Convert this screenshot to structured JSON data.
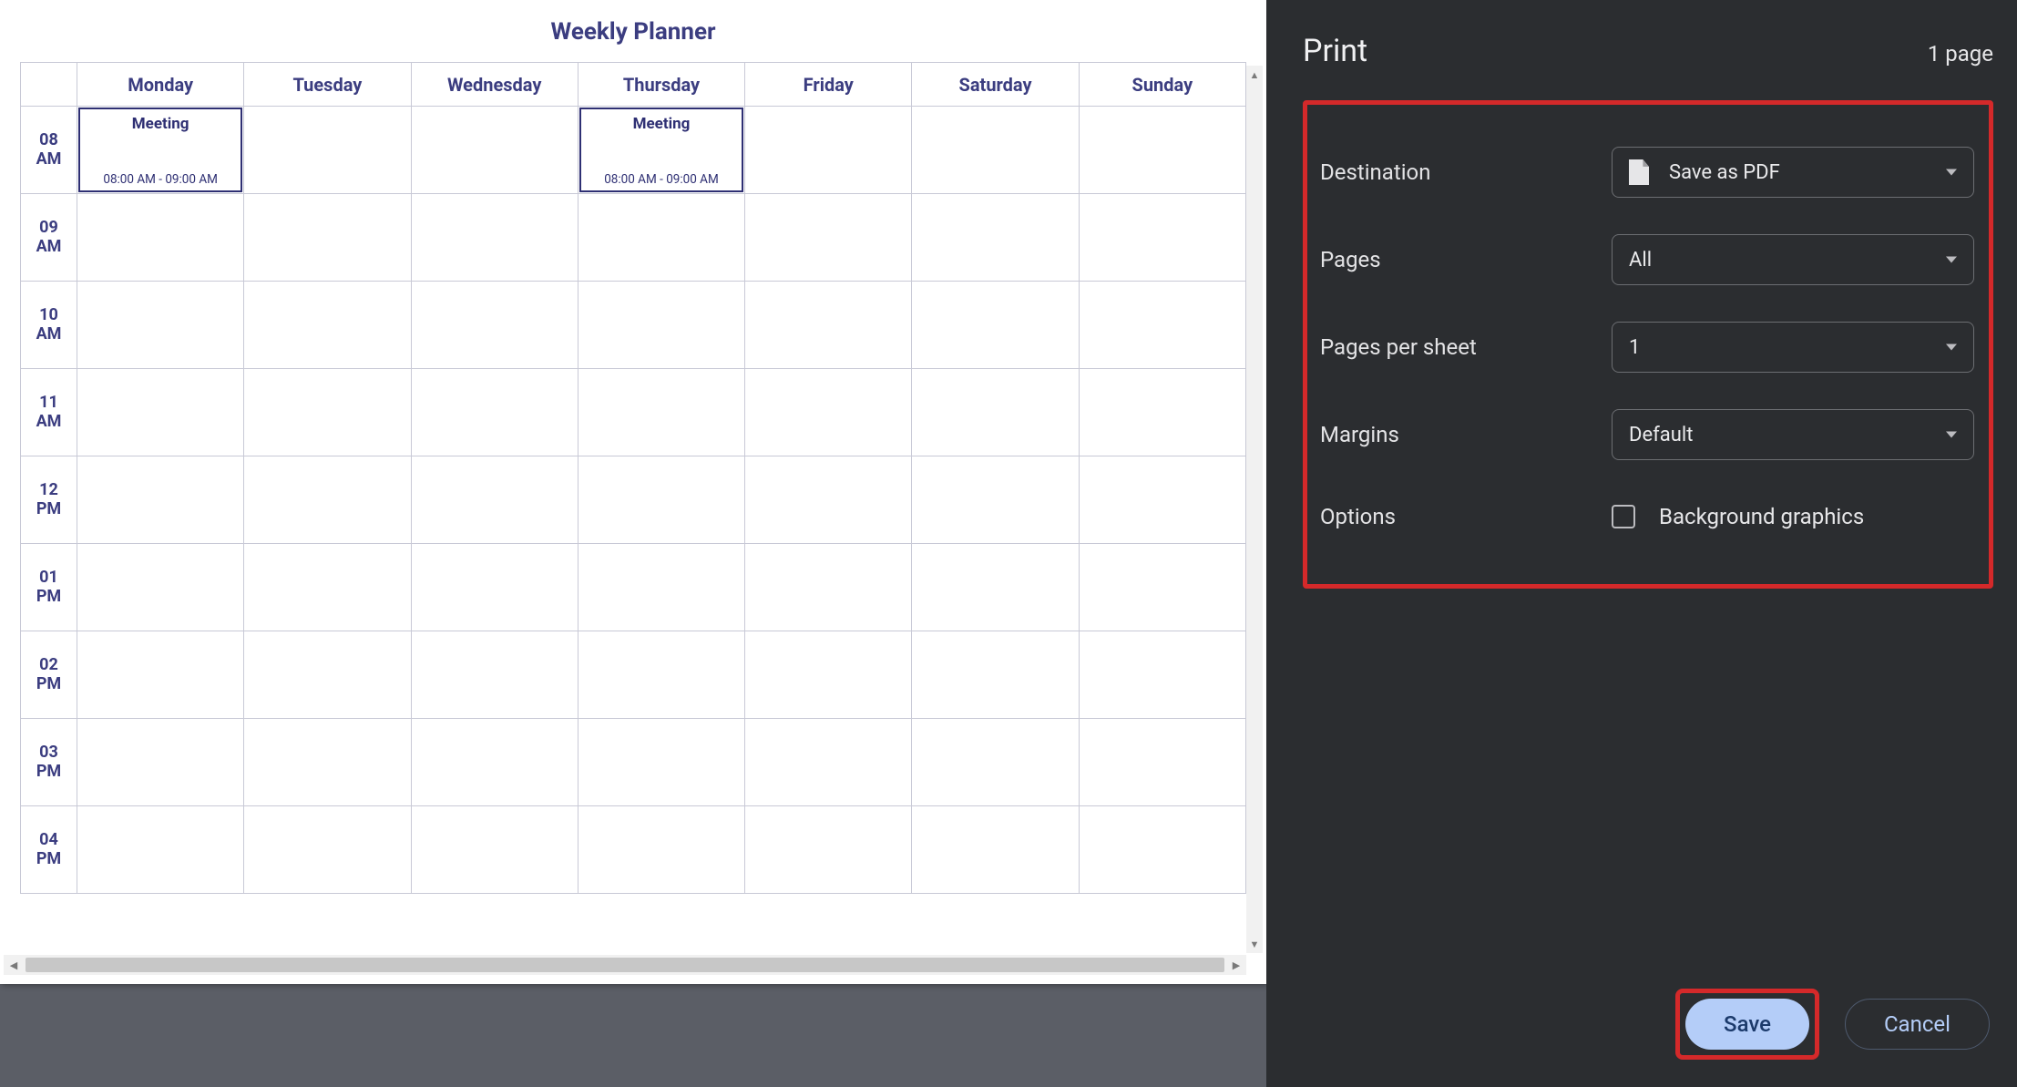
{
  "preview": {
    "title": "Weekly Planner",
    "days": [
      "Monday",
      "Tuesday",
      "Wednesday",
      "Thursday",
      "Friday",
      "Saturday",
      "Sunday"
    ],
    "timeslots": [
      {
        "hour": "08",
        "ampm": "AM"
      },
      {
        "hour": "09",
        "ampm": "AM"
      },
      {
        "hour": "10",
        "ampm": "AM"
      },
      {
        "hour": "11",
        "ampm": "AM"
      },
      {
        "hour": "12",
        "ampm": "PM"
      },
      {
        "hour": "01",
        "ampm": "PM"
      },
      {
        "hour": "02",
        "ampm": "PM"
      },
      {
        "hour": "03",
        "ampm": "PM"
      },
      {
        "hour": "04",
        "ampm": "PM"
      }
    ],
    "events": [
      {
        "day": 0,
        "slot": 0,
        "title": "Meeting",
        "time": "08:00 AM - 09:00 AM"
      },
      {
        "day": 3,
        "slot": 0,
        "title": "Meeting",
        "time": "08:00 AM - 09:00 AM"
      }
    ]
  },
  "panel": {
    "heading": "Print",
    "page_count": "1 page",
    "rows": {
      "destination": {
        "label": "Destination",
        "value": "Save as PDF"
      },
      "pages": {
        "label": "Pages",
        "value": "All"
      },
      "pps": {
        "label": "Pages per sheet",
        "value": "1"
      },
      "margins": {
        "label": "Margins",
        "value": "Default"
      },
      "options": {
        "label": "Options",
        "checkbox_label": "Background graphics",
        "checked": false
      }
    },
    "buttons": {
      "save": "Save",
      "cancel": "Cancel"
    }
  }
}
